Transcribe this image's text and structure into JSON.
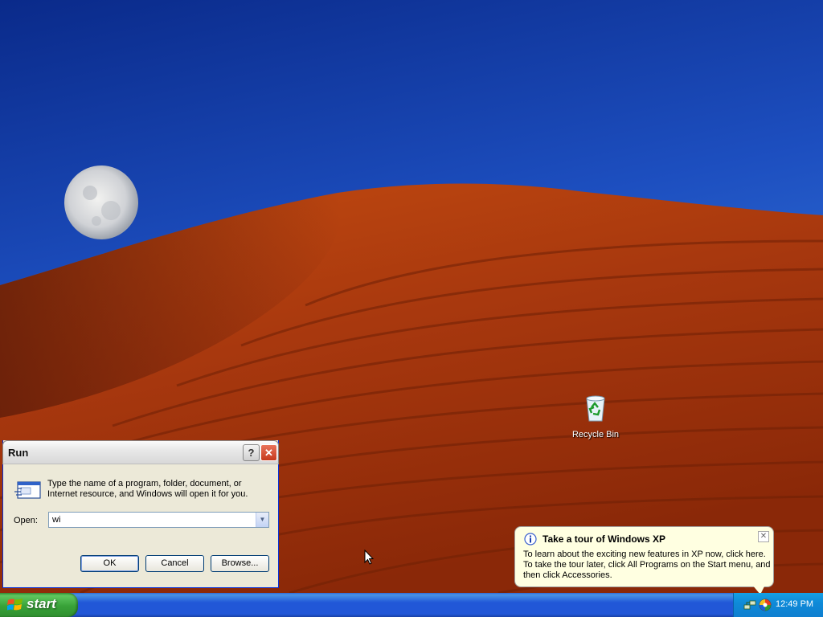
{
  "desktop": {
    "icons": [
      {
        "label": "Recycle Bin",
        "icon": "recycle-bin-icon"
      }
    ]
  },
  "run_dialog": {
    "title": "Run",
    "description": "Type the name of a program, folder, document, or Internet resource, and Windows will open it for you.",
    "open_label": "Open:",
    "open_value": "wi",
    "ok_label": "OK",
    "cancel_label": "Cancel",
    "browse_label": "Browse..."
  },
  "balloon": {
    "title": "Take a tour of Windows XP",
    "text": "To learn about the exciting new features in XP now, click here. To take the tour later, click All Programs on the Start menu, and then click Accessories."
  },
  "taskbar": {
    "start_label": "start",
    "clock": "12:49 PM",
    "tray_icons": [
      "network-icon",
      "security-center-icon"
    ]
  },
  "colors": {
    "taskbar_blue": "#2157d7",
    "start_green": "#38a238",
    "balloon_bg": "#ffffe1",
    "dialog_bg": "#ece9d8"
  }
}
